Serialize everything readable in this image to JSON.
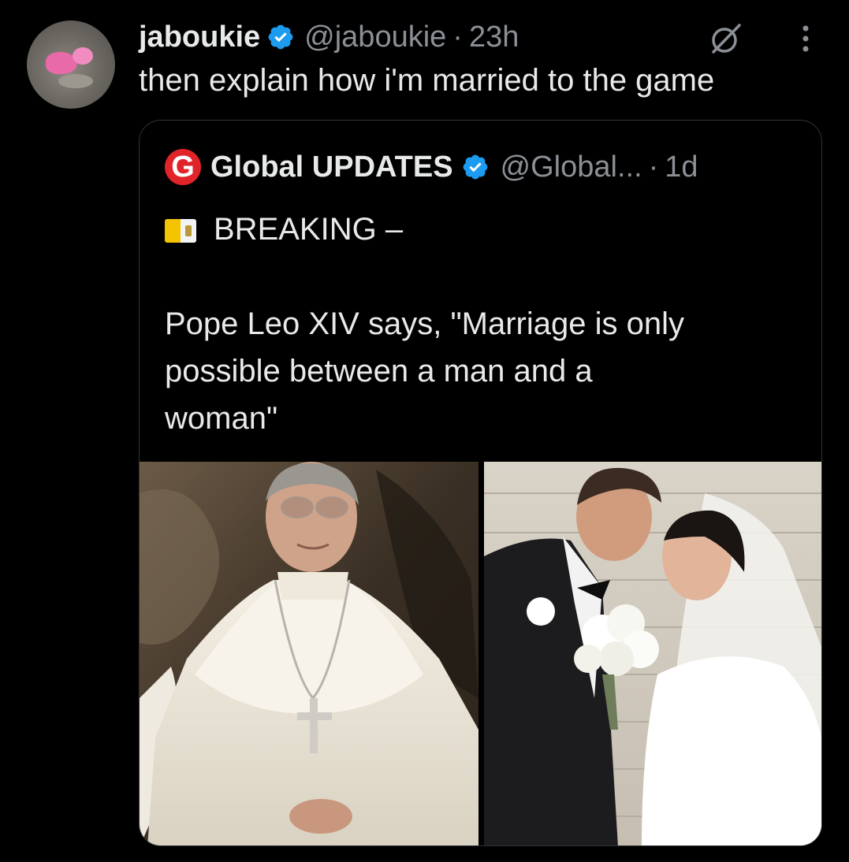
{
  "tweet": {
    "display_name": "jaboukie",
    "handle": "@jaboukie",
    "separator": "·",
    "time": "23h",
    "text": "then explain how i'm married to the game",
    "icons": {
      "verified": "verified-badge-icon",
      "grok": "grok-icon",
      "more": "more-options-icon"
    }
  },
  "quote": {
    "display_name": "Global UPDATES",
    "logo_letter": "G",
    "handle": "@Global...",
    "separator": "·",
    "time": "1d",
    "lines": [
      "BREAKING –",
      "",
      "Pope Leo XIV says, \"Marriage is only",
      "possible between a man and a",
      "woman\""
    ],
    "flag_icon": "vatican-flag-icon",
    "images": [
      {
        "name": "pope-photo"
      },
      {
        "name": "wedding-couple-photo"
      }
    ]
  },
  "colors": {
    "background": "#000000",
    "text": "#e7e9ea",
    "muted": "#8b9096",
    "verified": "#1d9bf0",
    "logo_red": "#e0242a",
    "border": "#2f3336"
  }
}
